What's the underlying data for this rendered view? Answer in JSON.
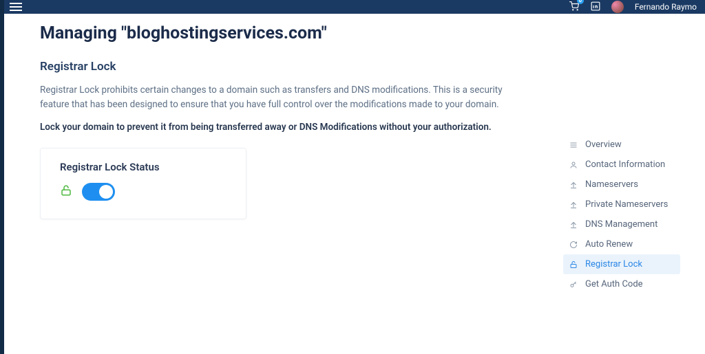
{
  "header": {
    "cart_count": "0",
    "username": "Fernando Raymo"
  },
  "page": {
    "title": "Managing \"bloghostingservices.com\"",
    "section_title": "Registrar Lock",
    "description": "Registrar Lock prohibits certain changes to a domain such as transfers and DNS modifications. This is a security feature that has been designed to ensure that you have full control over the modifications made to your domain.",
    "bold_description": "Lock your domain to prevent it from being transferred away or DNS Modifications without your authorization.",
    "card": {
      "title": "Registrar Lock Status",
      "toggle_on": true
    }
  },
  "sidebar": {
    "items": [
      {
        "label": "Overview"
      },
      {
        "label": "Contact Information"
      },
      {
        "label": "Nameservers"
      },
      {
        "label": "Private Nameservers"
      },
      {
        "label": "DNS Management"
      },
      {
        "label": "Auto Renew"
      },
      {
        "label": "Registrar Lock"
      },
      {
        "label": "Get Auth Code"
      }
    ],
    "active_index": 6
  }
}
